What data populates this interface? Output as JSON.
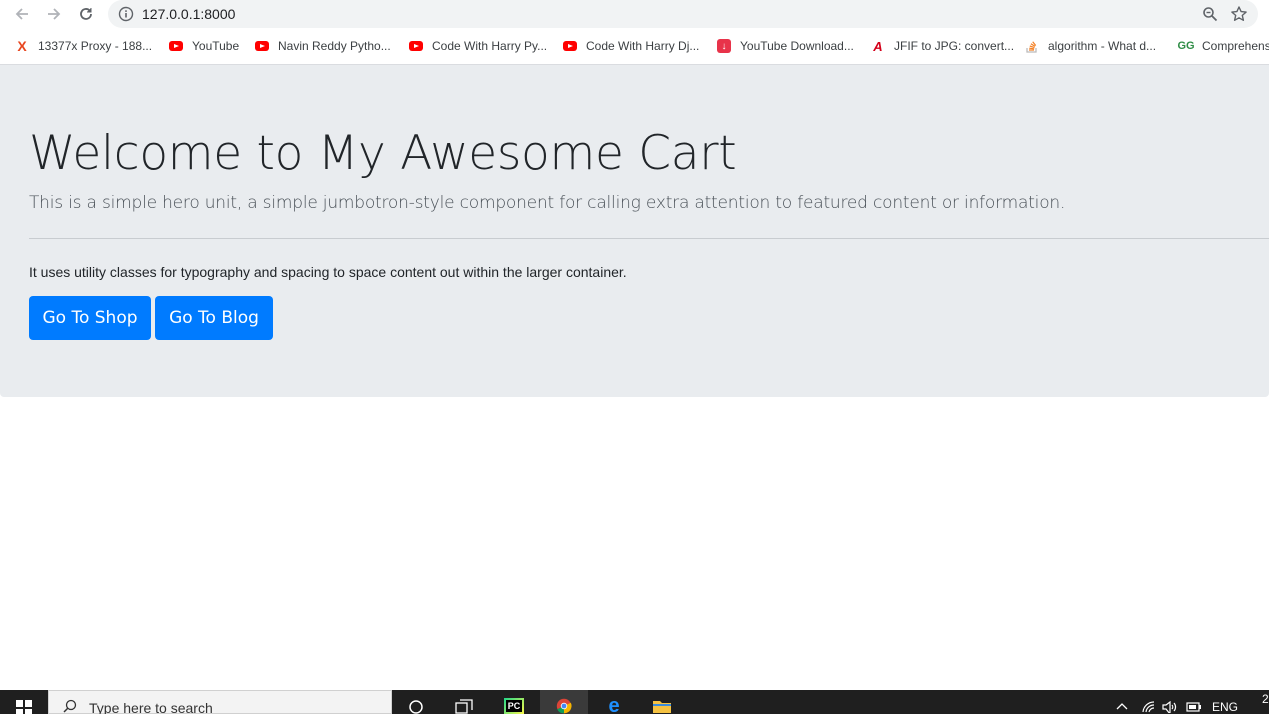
{
  "browser": {
    "url": "127.0.0.1:8000",
    "bookmarks": [
      {
        "label": "13377x Proxy - 188...",
        "icon": "x-icon"
      },
      {
        "label": "YouTube",
        "icon": "youtube-icon"
      },
      {
        "label": "Navin Reddy Pytho...",
        "icon": "youtube-icon"
      },
      {
        "label": "Code With Harry Py...",
        "icon": "youtube-icon"
      },
      {
        "label": "Code With Harry Dj...",
        "icon": "youtube-icon"
      },
      {
        "label": "YouTube Download...",
        "icon": "download-icon"
      },
      {
        "label": "JFIF to JPG: convert...",
        "icon": "adobe-icon"
      },
      {
        "label": "algorithm - What d...",
        "icon": "stackoverflow-icon"
      },
      {
        "label": "Comprehens",
        "icon": "geeksforgeeks-icon"
      }
    ]
  },
  "page": {
    "title": "Welcome to My Awesome Cart",
    "lead": "This is a simple hero unit, a simple jumbotron-style component for calling extra attention to featured content or information.",
    "body": "It uses utility classes for typography and spacing to space content out within the larger container.",
    "buttons": {
      "shop": "Go To Shop",
      "blog": "Go To Blog"
    }
  },
  "taskbar": {
    "search_placeholder": "Type here to search",
    "language": "ENG",
    "clock_fragment": "2"
  },
  "colors": {
    "primary": "#007bff",
    "jumbotron": "#e9ecef",
    "taskbar": "#1f1f1f"
  }
}
